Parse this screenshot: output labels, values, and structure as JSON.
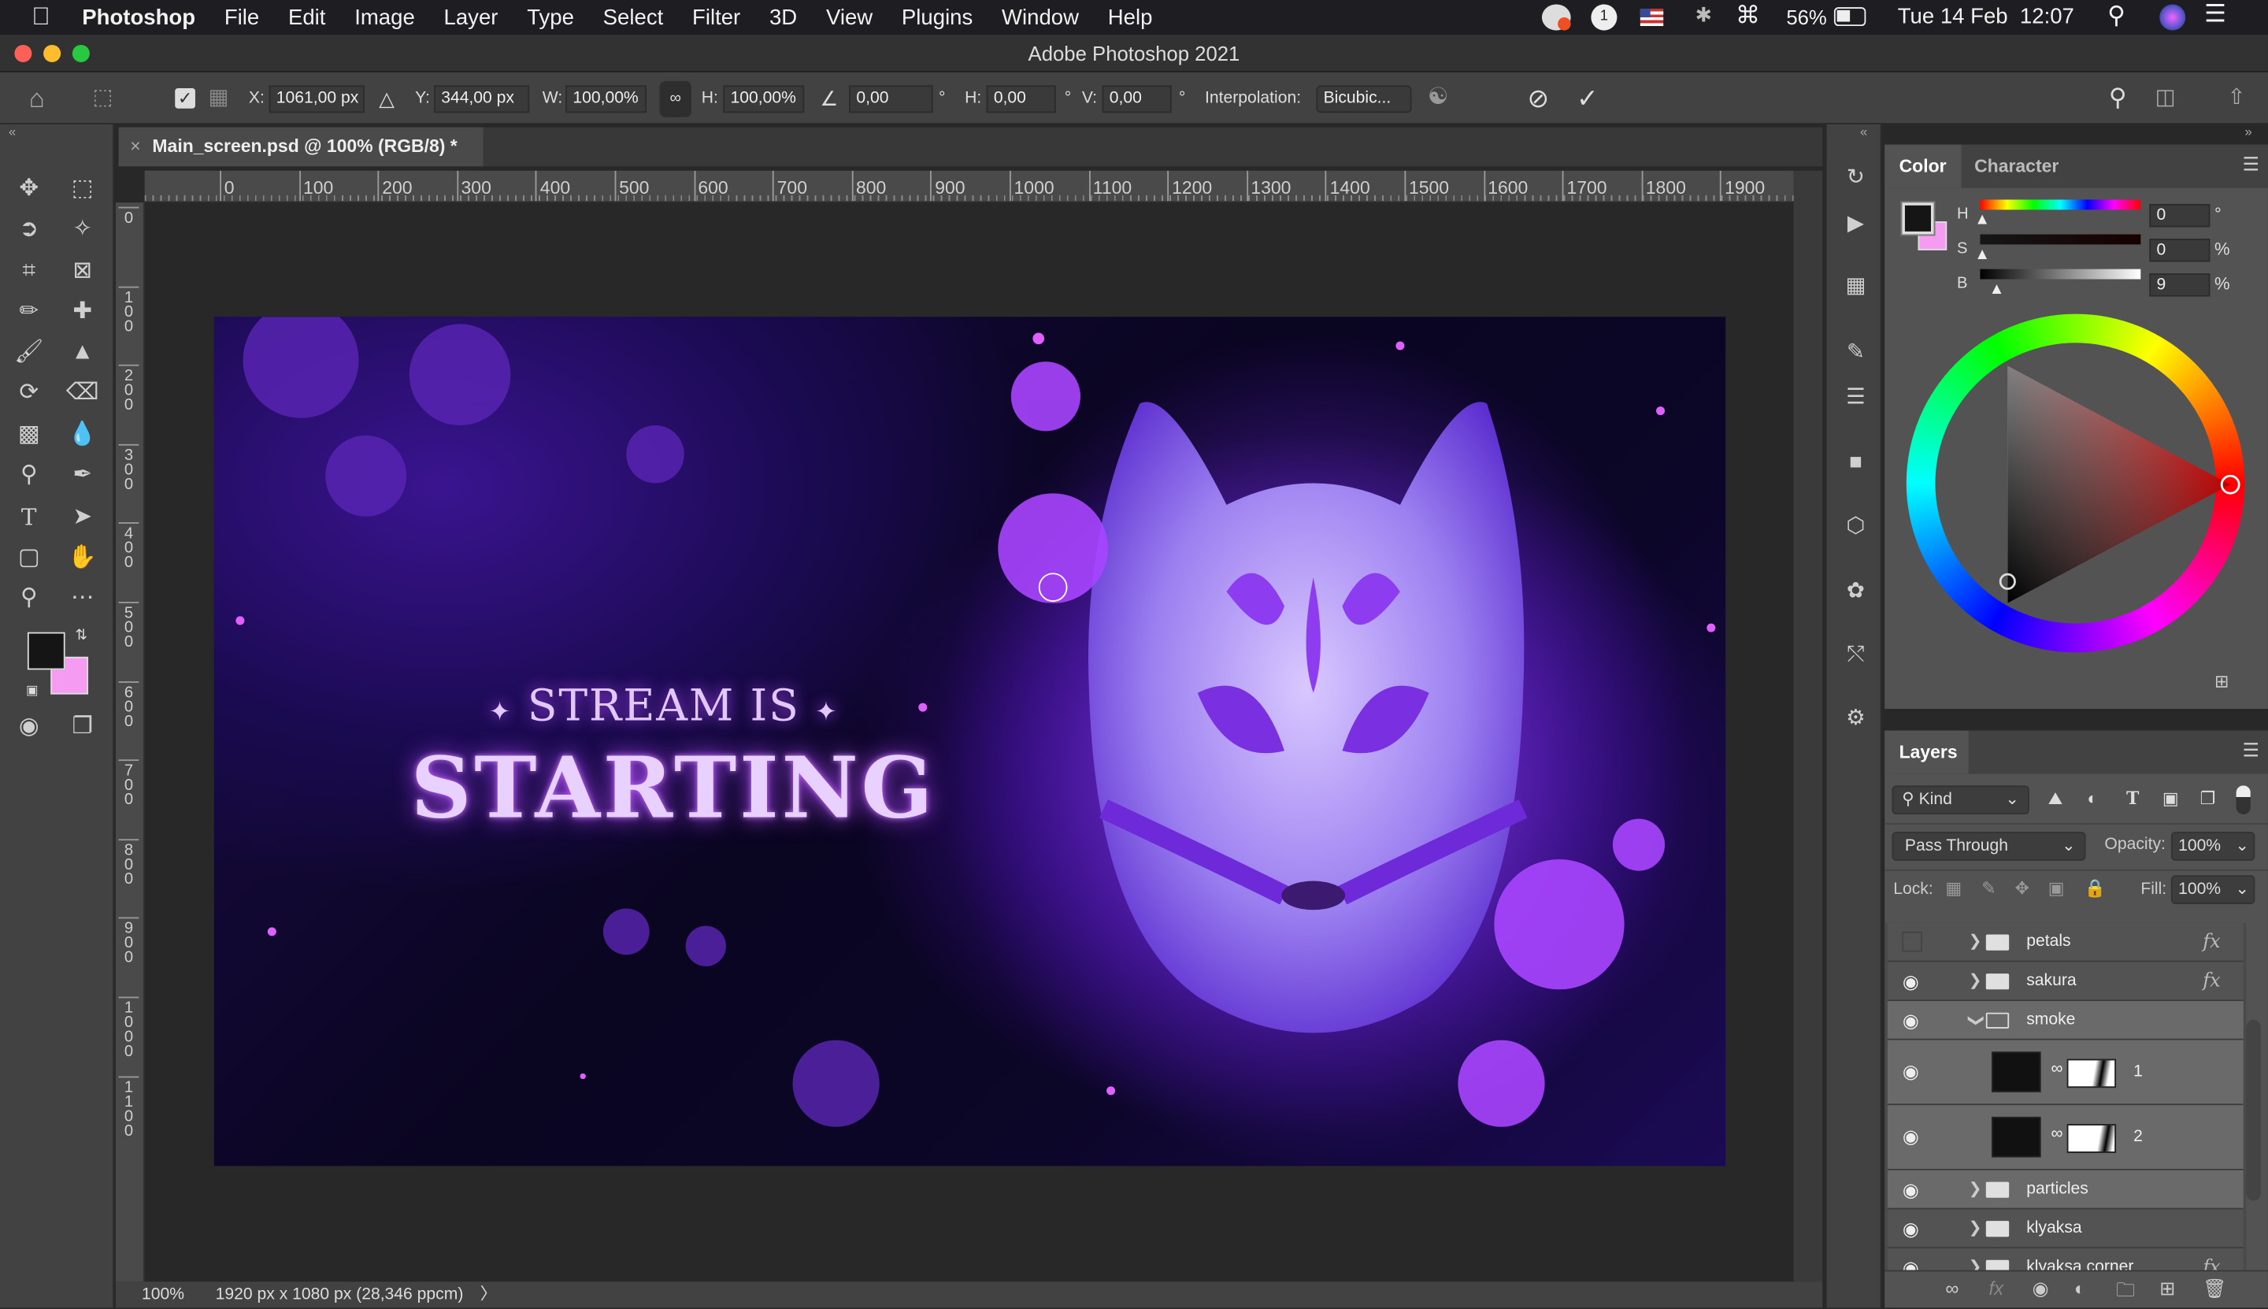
{
  "menubar": {
    "app": "Photoshop",
    "items": [
      "File",
      "Edit",
      "Image",
      "Layer",
      "Type",
      "Select",
      "Filter",
      "3D",
      "View",
      "Plugins",
      "Window",
      "Help"
    ],
    "battery": "56%",
    "clock": "Tue 14 Feb  12:07",
    "notification_count": "1"
  },
  "window": {
    "title": "Adobe Photoshop 2021"
  },
  "options": {
    "x_label": "X:",
    "x_value": "1061,00 px",
    "y_label": "Y:",
    "y_value": "344,00 px",
    "w_label": "W:",
    "w_value": "100,00%",
    "h_label": "H:",
    "h_value": "100,00%",
    "angle_value": "0,00",
    "deg": "°",
    "hskew_label": "H:",
    "hskew_value": "0,00",
    "vskew_label": "V:",
    "vskew_value": "0,00",
    "interp_label": "Interpolation:",
    "interp_value": "Bicubic..."
  },
  "document": {
    "tab_title": "Main_screen.psd @ 100% (RGB/8) *",
    "close": "×"
  },
  "rulers": {
    "top": [
      "0",
      "100",
      "200",
      "300",
      "400",
      "500",
      "600",
      "700",
      "800",
      "900",
      "1000",
      "1100",
      "1200",
      "1300",
      "1400",
      "1500",
      "1600",
      "1700",
      "1800",
      "1900"
    ],
    "left": [
      "0",
      "100",
      "200",
      "300",
      "400",
      "500",
      "600",
      "700",
      "800",
      "900",
      "1000",
      "1100"
    ]
  },
  "artwork": {
    "line1": "STREAM IS",
    "line2": "STARTING",
    "star": "✦"
  },
  "status": {
    "zoom": "100%",
    "info": "1920 px x 1080 px (28,346 ppcm)",
    "arrow": "〉"
  },
  "color_panel": {
    "tabs": [
      "Color",
      "Character"
    ],
    "foreground": "#151515",
    "background": "#f59cf2",
    "h_label": "H",
    "h_value": "0",
    "h_unit": "°",
    "s_label": "S",
    "s_value": "0",
    "s_unit": "%",
    "b_label": "B",
    "b_value": "9",
    "b_unit": "%"
  },
  "layers_panel": {
    "tab": "Layers",
    "filter": "Kind",
    "blend_mode": "Pass Through",
    "opacity_label": "Opacity:",
    "opacity": "100%",
    "lock_label": "Lock:",
    "fill_label": "Fill:",
    "fill": "100%",
    "layers": [
      {
        "name": "petals",
        "visible": false,
        "type": "group",
        "fx": "fx"
      },
      {
        "name": "sakura",
        "visible": true,
        "type": "group",
        "fx": "fx"
      },
      {
        "name": "smoke",
        "visible": true,
        "type": "group-open",
        "fx": ""
      },
      {
        "name": "1",
        "visible": true,
        "type": "masked-layer",
        "fx": ""
      },
      {
        "name": "2",
        "visible": true,
        "type": "masked-layer",
        "fx": ""
      },
      {
        "name": "particles",
        "visible": true,
        "type": "group",
        "fx": ""
      },
      {
        "name": "klyaksa",
        "visible": true,
        "type": "group",
        "fx": ""
      },
      {
        "name": "klyaksa corner",
        "visible": true,
        "type": "group",
        "fx": "fx"
      }
    ]
  },
  "accent": {
    "menubar_bg": "#1e1e22",
    "panel_bg": "#535353",
    "art_purple": "#8a3cff"
  }
}
